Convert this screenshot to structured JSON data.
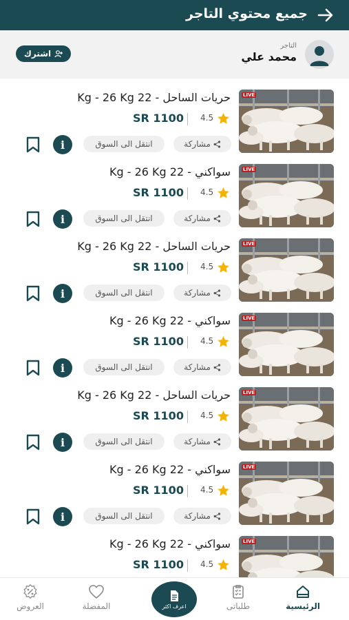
{
  "header": {
    "title": "جميع محتوي التاجر"
  },
  "merchant": {
    "label": "التاجر",
    "name": "محمد علي",
    "subscribe_label": "اشترك"
  },
  "listing_actions": {
    "share_label": "مشاركة",
    "goto_label": "انتقل الى السوق",
    "info_label": "i",
    "live_label": "LIVE"
  },
  "items": [
    {
      "name": "حريات الساحل  -  22 Kg - 26 Kg",
      "price": "SR 1100",
      "rating": "4.5"
    },
    {
      "name": "سواكني  -  22 Kg - 26 Kg",
      "price": "SR 1100",
      "rating": "4.5"
    },
    {
      "name": "حريات الساحل  -  22 Kg - 26 Kg",
      "price": "SR 1100",
      "rating": "4.5"
    },
    {
      "name": "سواكني  -  22 Kg - 26 Kg",
      "price": "SR 1100",
      "rating": "4.5"
    },
    {
      "name": "حريات الساحل  -  22 Kg - 26 Kg",
      "price": "SR 1100",
      "rating": "4.5"
    },
    {
      "name": "سواكني  -  22 Kg - 26 Kg",
      "price": "SR 1100",
      "rating": "4.5"
    },
    {
      "name": "سواكني  -  22 Kg - 26 Kg",
      "price": "SR 1100",
      "rating": "4.5"
    }
  ],
  "tabs": {
    "home": "الرئيسية",
    "orders": "طلباتى",
    "center": "اعرف اكثر",
    "favorites": "المفضلة",
    "offers": "العروض"
  },
  "colors": {
    "primary": "#1c4a53",
    "star": "#f5b301",
    "background": "#ffffff"
  },
  "icons": [
    "arrow-right-icon",
    "user-icon",
    "add-user-icon",
    "star-icon",
    "share-icon",
    "info-icon",
    "bookmark-icon",
    "home-icon",
    "clipboard-icon",
    "document-icon",
    "heart-icon",
    "percent-badge-icon"
  ]
}
